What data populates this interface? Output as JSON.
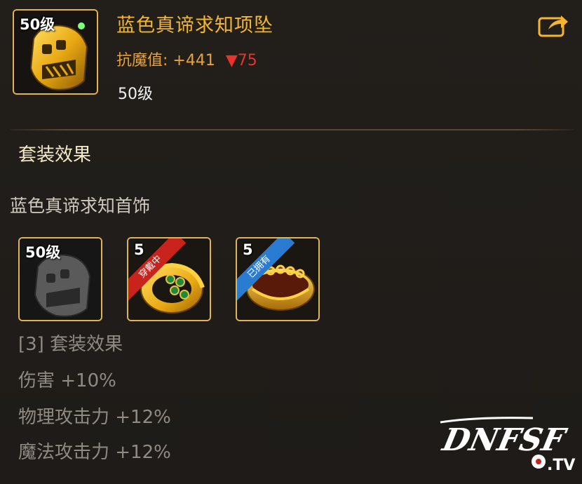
{
  "item": {
    "level_tag": "50级",
    "name": "蓝色真谛求知项坠",
    "stat_label": "抗魔值:",
    "stat_value": "+441",
    "stat_change": "▼75",
    "required_level": "50级"
  },
  "set": {
    "section_title": "套装效果",
    "set_name": "蓝色真谛求知首饰",
    "pieces": [
      {
        "level_tag": "50级",
        "state": "missing"
      },
      {
        "level_tag": "5",
        "ribbon": "穿戴中",
        "state": "equipped"
      },
      {
        "level_tag": "5",
        "ribbon": "已拥有",
        "state": "owned"
      }
    ],
    "effect_header": "[3] 套装效果",
    "effects": [
      "伤害 +10%",
      "物理攻击力 +12%",
      "魔法攻击力 +12%"
    ]
  },
  "watermark": {
    "logo_text": "DNFSF",
    "suffix": ".TV"
  },
  "colors": {
    "title_gold": "#f4b62c",
    "stat_orange": "#e8a23a",
    "down_red": "#e8322c",
    "border_gold": "#e0b450",
    "inactive_text": "#8f8a82"
  }
}
